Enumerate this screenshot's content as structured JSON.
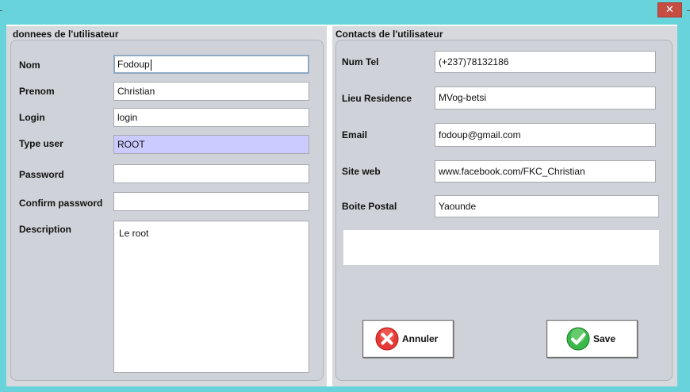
{
  "window": {
    "close_glyph": "✕"
  },
  "left_panel": {
    "title": "donnees de l'utilisateur",
    "fields": {
      "nom": {
        "label": "Nom",
        "value": "Fodoup"
      },
      "prenom": {
        "label": "Prenom",
        "value": "Christian"
      },
      "login": {
        "label": "Login",
        "value": "login"
      },
      "type_user": {
        "label": "Type user",
        "value": "ROOT"
      },
      "password": {
        "label": "Password",
        "value": ""
      },
      "confirm_password": {
        "label": "Confirm password",
        "value": ""
      },
      "description": {
        "label": "Description",
        "value": "Le root"
      }
    }
  },
  "right_panel": {
    "title": "Contacts de l'utilisateur",
    "fields": {
      "num_tel": {
        "label": "Num Tel",
        "value": "(+237)78132186"
      },
      "lieu_residence": {
        "label": "Lieu Residence",
        "value": "MVog-betsi"
      },
      "email": {
        "label": "Email",
        "value": "fodoup@gmail.com"
      },
      "site_web": {
        "label": "Site web",
        "value": "www.facebook.com/FKC_Christian"
      },
      "boite_postal": {
        "label": "Boite Postal",
        "value": "Yaounde"
      }
    },
    "buttons": {
      "annuler": {
        "label": "Annuler",
        "icon": "cancel-x-icon"
      },
      "save": {
        "label": "Save",
        "icon": "checkmark-icon"
      }
    }
  },
  "colors": {
    "window_frame": "#69d3dc",
    "close_button": "#c64d42",
    "panel_bg": "#d7d9de",
    "select_bg": "#cbcbff",
    "cancel_icon": "#e53935",
    "save_icon": "#3bb84a"
  }
}
